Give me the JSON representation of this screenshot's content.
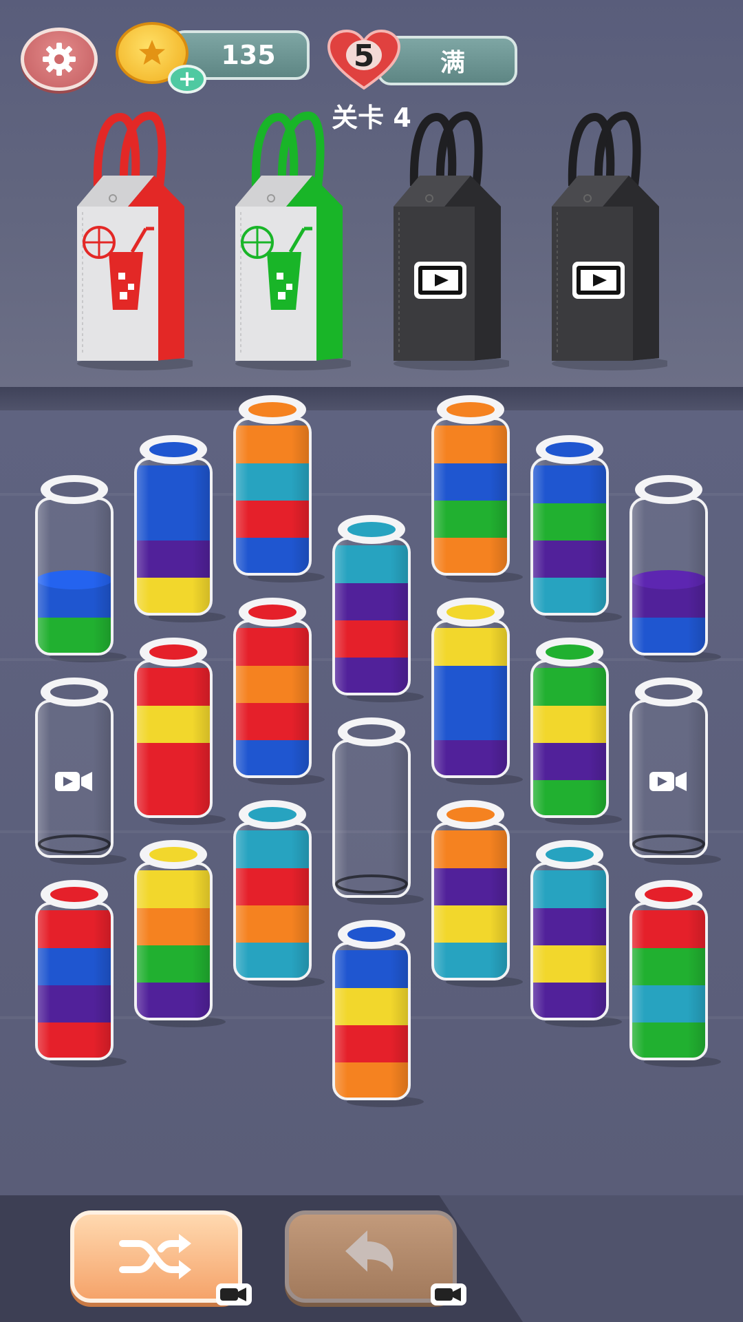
{
  "hud": {
    "coins": "135",
    "lives": "5",
    "lives_status": "满",
    "level_label": "关卡 4",
    "coin_add_symbol": "+"
  },
  "bags": [
    {
      "color": "#e32826",
      "state": "filled",
      "icon": "juice-cup-icon"
    },
    {
      "color": "#19b528",
      "state": "filled",
      "icon": "juice-cup-icon"
    },
    {
      "color": "#2e2e31",
      "state": "locked",
      "icon": "video-ad-icon"
    },
    {
      "color": "#2e2e31",
      "state": "locked",
      "icon": "video-ad-icon"
    }
  ],
  "colors": {
    "orange": "#f58220",
    "teal": "#27a3c0",
    "red": "#e5202a",
    "blue": "#1f56d0",
    "green": "#21b030",
    "purple": "#51219a",
    "yellow": "#f2d72c"
  },
  "bottles": [
    {
      "id": "b1",
      "col": 0,
      "row": 0,
      "layers": [
        "green",
        "blue"
      ],
      "capacity": 4,
      "locked": false
    },
    {
      "id": "b2",
      "col": 1,
      "row": 0,
      "layers": [
        "yellow",
        "purple",
        "blue",
        "blue"
      ],
      "capacity": 4,
      "locked": false
    },
    {
      "id": "b3",
      "col": 2,
      "row": 0,
      "layers": [
        "blue",
        "red",
        "teal",
        "orange"
      ],
      "capacity": 4,
      "locked": false
    },
    {
      "id": "b4",
      "col": 3,
      "row": 0,
      "layers": [
        "purple",
        "red",
        "purple",
        "teal"
      ],
      "capacity": 4,
      "locked": false
    },
    {
      "id": "b5",
      "col": 4,
      "row": 0,
      "layers": [
        "orange",
        "green",
        "blue",
        "orange"
      ],
      "capacity": 4,
      "locked": false
    },
    {
      "id": "b6",
      "col": 5,
      "row": 0,
      "layers": [
        "teal",
        "purple",
        "green",
        "blue"
      ],
      "capacity": 4,
      "locked": false
    },
    {
      "id": "b7",
      "col": 6,
      "row": 0,
      "layers": [
        "blue",
        "purple"
      ],
      "capacity": 4,
      "locked": false
    },
    {
      "id": "b8",
      "col": 0,
      "row": 1,
      "layers": [],
      "capacity": 4,
      "locked": true
    },
    {
      "id": "b9",
      "col": 1,
      "row": 1,
      "layers": [
        "red",
        "red",
        "yellow",
        "red"
      ],
      "capacity": 4,
      "locked": false
    },
    {
      "id": "b10",
      "col": 2,
      "row": 1,
      "layers": [
        "blue",
        "red",
        "orange",
        "red"
      ],
      "capacity": 4,
      "locked": false
    },
    {
      "id": "b11",
      "col": 3,
      "row": 1,
      "layers": [],
      "capacity": 4,
      "locked": false
    },
    {
      "id": "b12",
      "col": 4,
      "row": 1,
      "layers": [
        "purple",
        "blue",
        "blue",
        "yellow"
      ],
      "capacity": 4,
      "locked": false
    },
    {
      "id": "b13",
      "col": 5,
      "row": 1,
      "layers": [
        "green",
        "purple",
        "yellow",
        "green"
      ],
      "capacity": 4,
      "locked": false
    },
    {
      "id": "b14",
      "col": 6,
      "row": 1,
      "layers": [],
      "capacity": 4,
      "locked": true
    },
    {
      "id": "b15",
      "col": 0,
      "row": 2,
      "layers": [
        "red",
        "purple",
        "blue",
        "red"
      ],
      "capacity": 4,
      "locked": false
    },
    {
      "id": "b16",
      "col": 1,
      "row": 2,
      "layers": [
        "purple",
        "green",
        "orange",
        "yellow"
      ],
      "capacity": 4,
      "locked": false
    },
    {
      "id": "b17",
      "col": 2,
      "row": 2,
      "layers": [
        "teal",
        "orange",
        "red",
        "teal"
      ],
      "capacity": 4,
      "locked": false
    },
    {
      "id": "b18",
      "col": 3,
      "row": 2,
      "layers": [
        "orange",
        "red",
        "yellow",
        "blue"
      ],
      "capacity": 4,
      "locked": false
    },
    {
      "id": "b19",
      "col": 4,
      "row": 2,
      "layers": [
        "teal",
        "yellow",
        "purple",
        "orange"
      ],
      "capacity": 4,
      "locked": false
    },
    {
      "id": "b20",
      "col": 5,
      "row": 2,
      "layers": [
        "purple",
        "yellow",
        "purple",
        "teal"
      ],
      "capacity": 4,
      "locked": false
    },
    {
      "id": "b21",
      "col": 6,
      "row": 2,
      "layers": [
        "green",
        "teal",
        "green",
        "red"
      ],
      "capacity": 4,
      "locked": false
    }
  ],
  "actions": {
    "shuffle_icon": "shuffle-icon",
    "undo_icon": "undo-icon",
    "ad_icon": "video-camera-icon"
  }
}
